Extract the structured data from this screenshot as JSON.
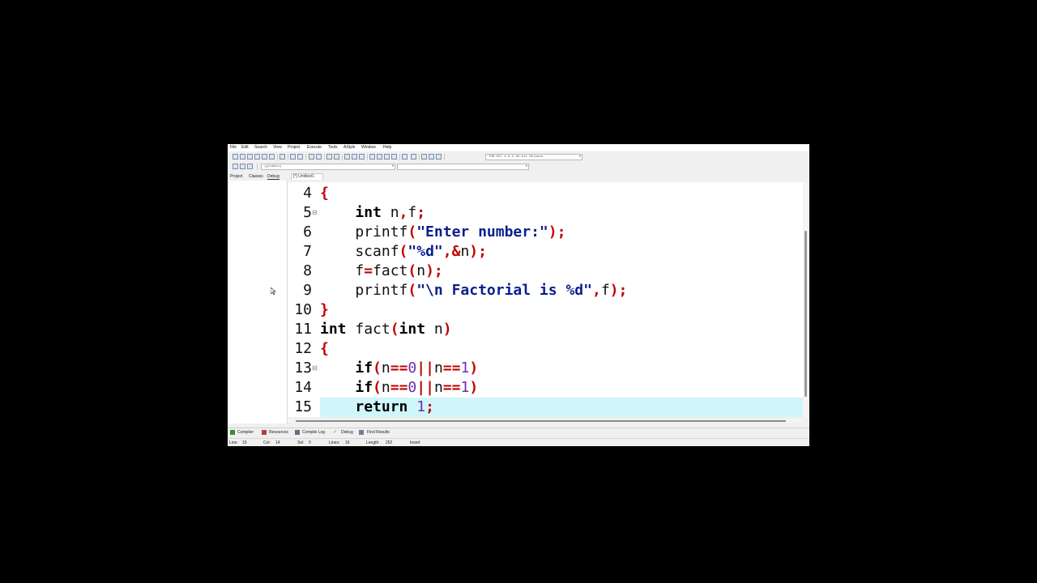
{
  "menu": [
    "File",
    "Edit",
    "Search",
    "View",
    "Project",
    "Execute",
    "Tools",
    "AStyle",
    "Window",
    "Help"
  ],
  "toolbar": {
    "compiler_select": "TDM-GCC 4.9.2 64-bit Release",
    "globals_select": "(globals)",
    "function_select": ""
  },
  "left_tabs": [
    "Project",
    "Classes",
    "Debug"
  ],
  "editor_tab": "[*] Untitled1",
  "editor": {
    "lines": [
      {
        "n": "4",
        "fold": false,
        "current": false
      },
      {
        "n": "5",
        "fold": true,
        "current": false
      },
      {
        "n": "6",
        "fold": false,
        "current": false
      },
      {
        "n": "7",
        "fold": false,
        "current": false
      },
      {
        "n": "8",
        "fold": false,
        "current": false
      },
      {
        "n": "9",
        "fold": false,
        "current": false
      },
      {
        "n": "10",
        "fold": false,
        "current": false
      },
      {
        "n": "11",
        "fold": false,
        "current": false
      },
      {
        "n": "12",
        "fold": false,
        "current": false
      },
      {
        "n": "13",
        "fold": true,
        "current": false
      },
      {
        "n": "14",
        "fold": false,
        "current": false
      },
      {
        "n": "15",
        "fold": false,
        "current": true
      }
    ],
    "code": [
      [
        {
          "t": "{",
          "c": "br"
        }
      ],
      [
        {
          "t": "    ",
          "c": ""
        },
        {
          "t": "int",
          "c": "kw"
        },
        {
          "t": " n",
          "c": "idn"
        },
        {
          "t": ",",
          "c": "op"
        },
        {
          "t": "f",
          "c": "idn"
        },
        {
          "t": ";",
          "c": "op"
        }
      ],
      [
        {
          "t": "    printf",
          "c": "idn"
        },
        {
          "t": "(",
          "c": "op"
        },
        {
          "t": "\"Enter number:\"",
          "c": "str"
        },
        {
          "t": ");",
          "c": "op"
        }
      ],
      [
        {
          "t": "    scanf",
          "c": "idn"
        },
        {
          "t": "(",
          "c": "op"
        },
        {
          "t": "\"%d\"",
          "c": "str"
        },
        {
          "t": ",&",
          "c": "op"
        },
        {
          "t": "n",
          "c": "idn"
        },
        {
          "t": ");",
          "c": "op"
        }
      ],
      [
        {
          "t": "    f",
          "c": "idn"
        },
        {
          "t": "=",
          "c": "op"
        },
        {
          "t": "fact",
          "c": "idn"
        },
        {
          "t": "(",
          "c": "op"
        },
        {
          "t": "n",
          "c": "idn"
        },
        {
          "t": ");",
          "c": "op"
        }
      ],
      [
        {
          "t": "    printf",
          "c": "idn"
        },
        {
          "t": "(",
          "c": "op"
        },
        {
          "t": "\"\\n Factorial is %d\"",
          "c": "str"
        },
        {
          "t": ",",
          "c": "op"
        },
        {
          "t": "f",
          "c": "idn"
        },
        {
          "t": ");",
          "c": "op"
        }
      ],
      [
        {
          "t": "}",
          "c": "br"
        }
      ],
      [
        {
          "t": "int",
          "c": "kw"
        },
        {
          "t": " fact",
          "c": "idn"
        },
        {
          "t": "(",
          "c": "op"
        },
        {
          "t": "int",
          "c": "kw"
        },
        {
          "t": " n",
          "c": "idn"
        },
        {
          "t": ")",
          "c": "op"
        }
      ],
      [
        {
          "t": "{",
          "c": "br"
        }
      ],
      [
        {
          "t": "    ",
          "c": ""
        },
        {
          "t": "if",
          "c": "kw"
        },
        {
          "t": "(",
          "c": "op"
        },
        {
          "t": "n",
          "c": "idn"
        },
        {
          "t": "==",
          "c": "op"
        },
        {
          "t": "0",
          "c": "num"
        },
        {
          "t": "||",
          "c": "op"
        },
        {
          "t": "n",
          "c": "idn"
        },
        {
          "t": "==",
          "c": "op"
        },
        {
          "t": "1",
          "c": "num"
        },
        {
          "t": ")",
          "c": "op"
        }
      ],
      [
        {
          "t": "    ",
          "c": ""
        },
        {
          "t": "if",
          "c": "kw"
        },
        {
          "t": "(",
          "c": "op"
        },
        {
          "t": "n",
          "c": "idn"
        },
        {
          "t": "==",
          "c": "op"
        },
        {
          "t": "0",
          "c": "num"
        },
        {
          "t": "||",
          "c": "op"
        },
        {
          "t": "n",
          "c": "idn"
        },
        {
          "t": "==",
          "c": "op"
        },
        {
          "t": "1",
          "c": "num"
        },
        {
          "t": ")",
          "c": "op"
        }
      ],
      [
        {
          "t": "    ",
          "c": ""
        },
        {
          "t": "return",
          "c": "kw"
        },
        {
          "t": " ",
          "c": ""
        },
        {
          "t": "1",
          "c": "num"
        },
        {
          "t": ";",
          "c": "op"
        }
      ]
    ]
  },
  "bottom_tabs": [
    "Compiler",
    "Resources",
    "Compile Log",
    "Debug",
    "Find Results"
  ],
  "status": {
    "line_label": "Line:",
    "line_value": "15",
    "col_label": "Col:",
    "col_value": "14",
    "sel_label": "Sel:",
    "sel_value": "0",
    "lines_label": "Lines:",
    "lines_value": "16",
    "length_label": "Length:",
    "length_value": "252",
    "mode": "Insert"
  },
  "colors": {
    "current_line": "#cff6fb",
    "bracket": "#c00000",
    "string": "#0b1f8c",
    "number": "#6b2fae"
  }
}
